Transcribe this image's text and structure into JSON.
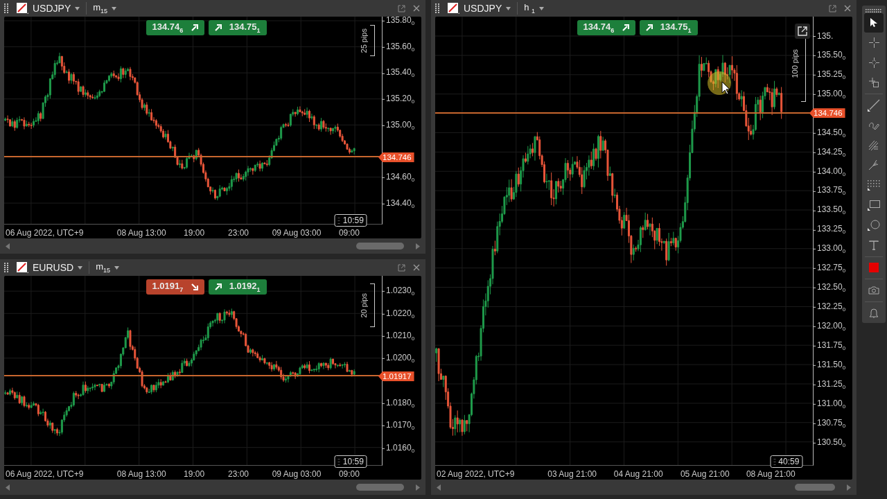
{
  "panels": [
    {
      "symbol": "USDJPY",
      "timeframe": "m$_{15}$",
      "quotes": [
        {
          "kind": "sell",
          "price": "134.74$_{6}$",
          "rising": true
        },
        {
          "kind": "buy",
          "price": "134.75$_{1}$",
          "rising": true
        }
      ],
      "y_axis": [
        "135.80$_{0}$",
        "135.60$_{0}$",
        "135.40$_{0}$",
        "135.20$_{0}$",
        "135.00$_{0}$",
        "134.60$_{0}$",
        "134.40$_{0}$"
      ],
      "current_price": "134.746",
      "pips": "25 pips",
      "timer": "10:59",
      "x_axis": [
        "06 Aug 2022, UTC+9",
        "08 Aug 13:00",
        "19:00",
        "23:00",
        "09 Aug 03:00",
        "09:00"
      ]
    },
    {
      "symbol": "EURUSD",
      "timeframe": "m$_{15}$",
      "quotes": [
        {
          "kind": "sell",
          "price": "1.0191$_{7}$",
          "rising": false
        },
        {
          "kind": "buy",
          "price": "1.0192$_{1}$",
          "rising": true
        }
      ],
      "y_axis": [
        "1.0230$_{0}$",
        "1.0220$_{0}$",
        "1.0210$_{0}$",
        "1.0200$_{0}$",
        "1.0180$_{0}$",
        "1.0170$_{0}$",
        "1.0160$_{0}$"
      ],
      "current_price": "1.01917",
      "pips": "20 pips",
      "timer": "10:59",
      "x_axis": [
        "06 Aug 2022, UTC+9",
        "08 Aug 13:00",
        "19:00",
        "23:00",
        "09 Aug 03:00",
        "09:00"
      ]
    },
    {
      "symbol": "USDJPY",
      "timeframe": "h $_{1}$",
      "fullscreen_button": true,
      "cursor_highlight": true,
      "quotes": [
        {
          "kind": "sell",
          "price": "134.74$_{6}$",
          "rising": true
        },
        {
          "kind": "buy",
          "price": "134.75$_{1}$",
          "rising": true
        }
      ],
      "y_axis": [
        "135.",
        "135.50$_{0}$",
        "135.25$_{0}$",
        "135.00$_{0}$",
        "134.50$_{0}$",
        "134.25$_{0}$",
        "134.00$_{0}$",
        "133.75$_{0}$",
        "133.50$_{0}$",
        "133.25$_{0}$",
        "133.00$_{0}$",
        "132.75$_{0}$",
        "132.50$_{0}$",
        "132.25$_{0}$",
        "132.00$_{0}$",
        "131.75$_{0}$",
        "131.50$_{0}$",
        "131.25$_{0}$",
        "131.00$_{0}$",
        "130.75$_{0}$",
        "130.50$_{0}$"
      ],
      "current_price": "134.746",
      "pips": "100 pips",
      "timer": "40:59",
      "x_axis": [
        "02 Aug 2022, UTC+9",
        "03 Aug 21:00",
        "04 Aug 21:00",
        "05 Aug 21:00",
        "08 Aug 21:00"
      ]
    }
  ],
  "toolbar": {
    "tools": [
      {
        "kind": "pointer",
        "selected": true
      },
      {
        "kind": "crosshair",
        "selected": false
      },
      {
        "kind": "crosshair-dots",
        "selected": false
      },
      {
        "kind": "crosshair-square",
        "selected": false
      },
      {
        "kind": "line",
        "selected": false
      },
      {
        "kind": "pen",
        "selected": false
      },
      {
        "kind": "hatch",
        "selected": false
      },
      {
        "kind": "pitchfork",
        "selected": false
      },
      {
        "kind": "grid",
        "selected": false
      },
      {
        "kind": "rectangle",
        "selected": false
      },
      {
        "kind": "ellipse",
        "selected": false
      },
      {
        "kind": "text",
        "selected": false
      },
      {
        "kind": "color",
        "selected": false,
        "color": "#e60000"
      },
      {
        "kind": "camera",
        "selected": false
      },
      {
        "kind": "bell",
        "selected": false
      }
    ]
  }
}
